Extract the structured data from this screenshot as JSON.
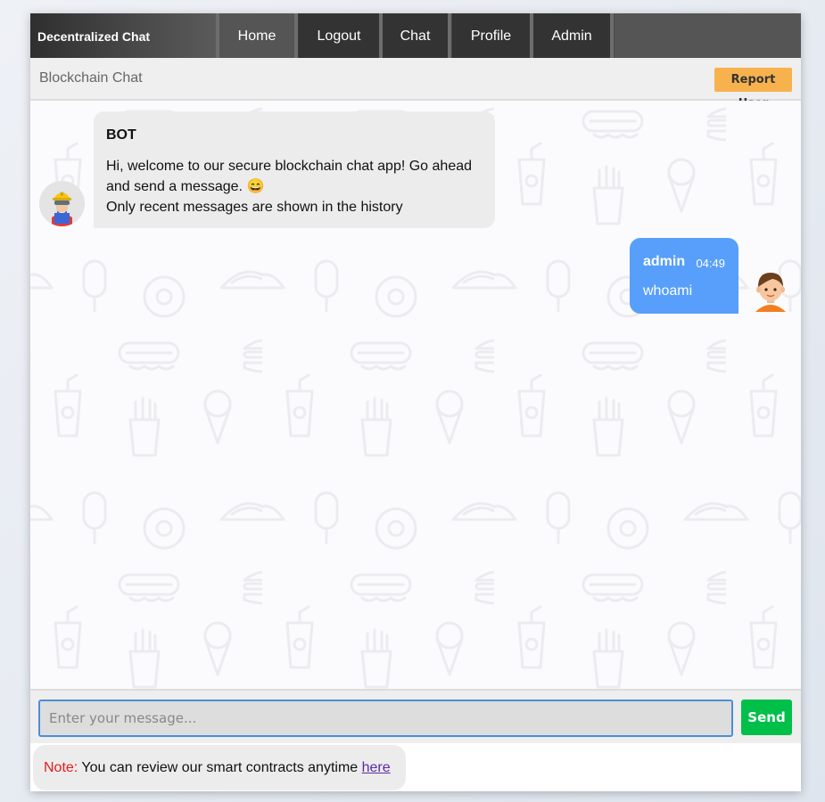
{
  "nav": {
    "brand": "Decentralized Chat",
    "items": [
      {
        "label": "Home"
      },
      {
        "label": "Logout"
      },
      {
        "label": "Chat"
      },
      {
        "label": "Profile"
      },
      {
        "label": "Admin"
      }
    ]
  },
  "subheader": {
    "title": "Blockchain Chat",
    "report_label": "Report User"
  },
  "messages": [
    {
      "sender": "BOT",
      "lines": [
        "Hi, welcome to our secure blockchain chat app! Go ahead",
        "and send a message. 😄",
        "Only recent messages are shown in the history"
      ],
      "avatar": "bot-avatar-icon"
    },
    {
      "sender": "admin",
      "time": "04:49",
      "text": "whoami",
      "avatar": "user-avatar-icon"
    }
  ],
  "composer": {
    "placeholder": "Enter your message...",
    "value": "",
    "send_label": "Send"
  },
  "note": {
    "label": "Note:",
    "text": " You can review our smart contracts anytime ",
    "link": "here"
  },
  "colors": {
    "nav_bg": "#333333",
    "report_btn": "#f8b24d",
    "admin_bubble": "#579ffb",
    "send_btn": "#00c04a",
    "note_label": "#e31b1b"
  }
}
